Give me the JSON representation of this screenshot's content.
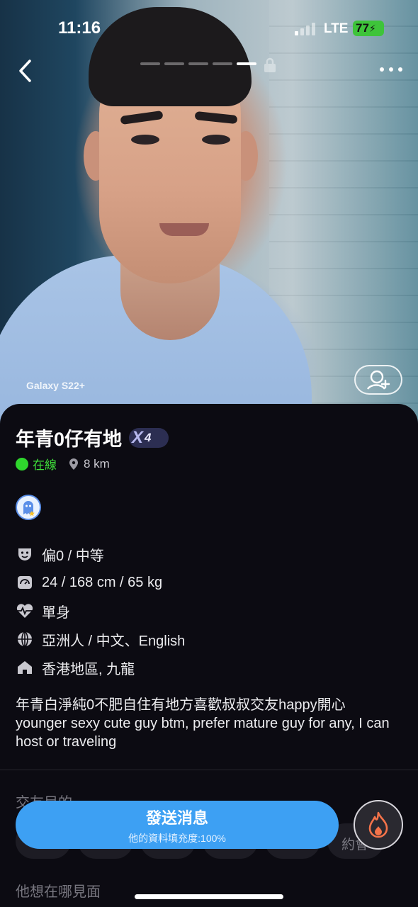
{
  "status_bar": {
    "time": "11:16",
    "network": "LTE",
    "battery": "77"
  },
  "photo": {
    "watermark": "Galaxy S22+",
    "indicator_count": 5,
    "active_index": 4
  },
  "profile": {
    "name": "年青0仔有地",
    "badge_symbol": "X",
    "badge_number": "4",
    "online_status": "在線",
    "distance": "8 km",
    "attributes": [
      {
        "icon": "mask-icon",
        "text": "偏0 / 中等"
      },
      {
        "icon": "scale-icon",
        "text": "24 / 168 cm / 65 kg"
      },
      {
        "icon": "heartbeat-icon",
        "text": "單身"
      },
      {
        "icon": "globe-icon",
        "text": "亞洲人 / 中文、English"
      },
      {
        "icon": "home-icon",
        "text": "香港地區, 九龍"
      }
    ],
    "bio": "年青白淨純0不肥自住有地方喜歡叔叔交友happy開心 younger sexy cute guy btm, prefer mature guy for any, I can host or traveling"
  },
  "sections": {
    "purpose_title": "交友目的",
    "purpose_visible_chip": "約會",
    "meet_title": "他想在哪見面"
  },
  "actions": {
    "send_label": "發送消息",
    "send_sublabel": "他的資料填充度:100%"
  },
  "colors": {
    "accent": "#3da0f3",
    "online": "#2fd62d",
    "background": "#0c0b12"
  }
}
